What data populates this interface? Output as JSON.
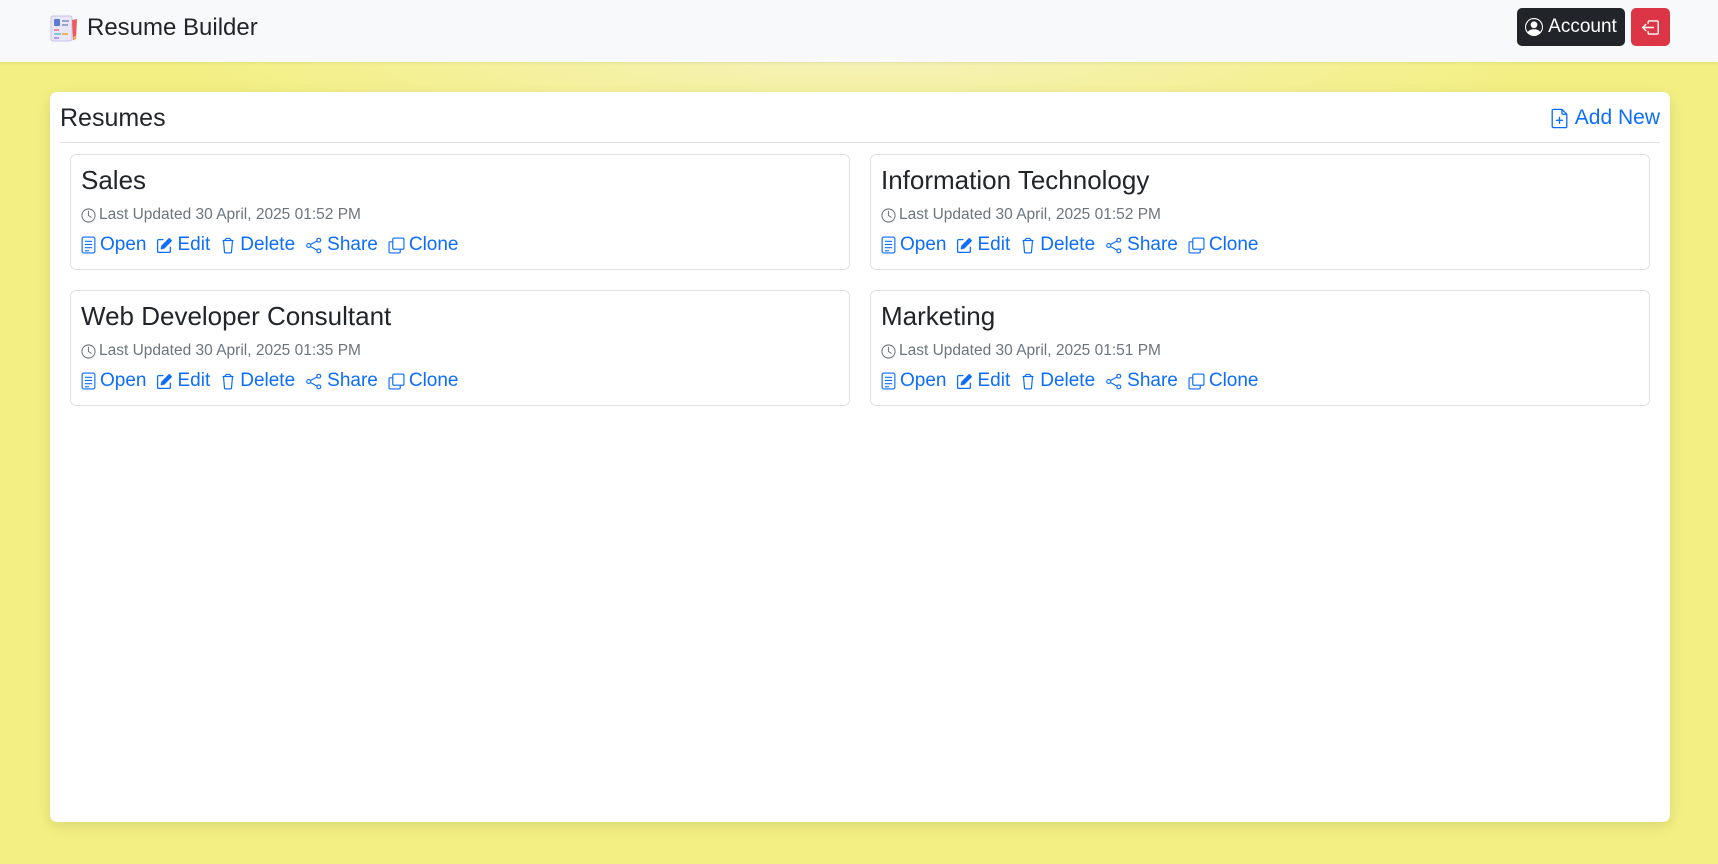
{
  "navbar": {
    "brand_name": "Resume Builder",
    "brand_icon": "resume-logo-icon",
    "account_label": "Account",
    "account_icon": "person-circle-icon",
    "logout_icon": "box-arrow-left-icon"
  },
  "panel": {
    "title": "Resumes",
    "add_new_label": "Add New",
    "add_new_icon": "file-earmark-plus-icon"
  },
  "resumes": [
    {
      "title": "Sales",
      "updated": "Last Updated 30 April, 2025 01:52 PM"
    },
    {
      "title": "Information Technology",
      "updated": "Last Updated 30 April, 2025 01:52 PM"
    },
    {
      "title": "Web Developer Consultant",
      "updated": "Last Updated 30 April, 2025 01:35 PM"
    },
    {
      "title": "Marketing",
      "updated": "Last Updated 30 April, 2025 01:51 PM"
    }
  ],
  "actions": {
    "open": "Open",
    "edit": "Edit",
    "delete": "Delete",
    "share": "Share",
    "clone": "Clone"
  },
  "colors": {
    "page_background": "#f3ef82",
    "navbar_background": "#f8f9fa",
    "link": "#0d6efd",
    "account_button": "#212529",
    "logout_button": "#dc3545",
    "muted_text": "#6c757d"
  }
}
